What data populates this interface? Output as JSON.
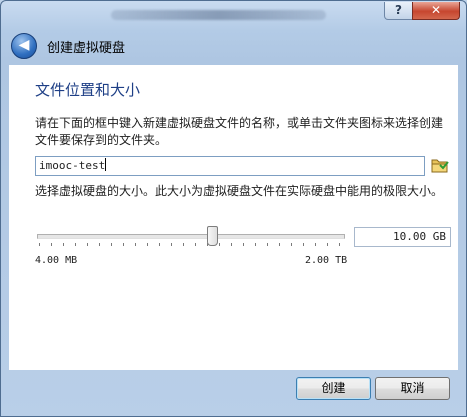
{
  "window": {
    "help_label": "?",
    "close_label": "✕"
  },
  "nav": {
    "back_glyph": "◀",
    "title": "创建虚拟硬盘"
  },
  "page": {
    "title": "文件位置和大小",
    "description": "请在下面的框中键入新建虚拟硬盘文件的名称，或单击文件夹图标来选择创建文件要保存到的文件夹。"
  },
  "file_name": {
    "value": "imooc-test"
  },
  "size": {
    "description": "选择虚拟硬盘的大小。此大小为虚拟硬盘文件在实际硬盘中能用的极限大小。",
    "value": "10.00 GB",
    "min_label": "4.00 MB",
    "max_label": "2.00 TB",
    "slider_fraction": 0.58
  },
  "buttons": {
    "create": "创建",
    "cancel": "取消"
  },
  "icons": {
    "back": "back-arrow-icon",
    "folder": "folder-icon"
  }
}
